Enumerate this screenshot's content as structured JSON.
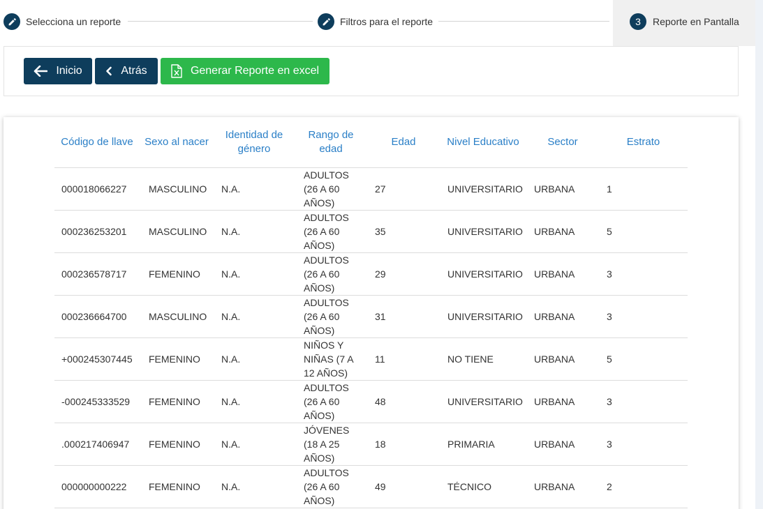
{
  "stepper": {
    "steps": [
      {
        "label": "Selecciona un reporte",
        "icon": "pencil-icon"
      },
      {
        "label": "Filtros para el reporte",
        "icon": "pencil-icon"
      },
      {
        "number": "3",
        "label": "Reporte en Pantalla"
      }
    ]
  },
  "toolbar": {
    "inicio_label": "Inicio",
    "atras_label": "Atrás",
    "excel_label": "Generar Reporte en excel"
  },
  "colors": {
    "primary": "#0e3d5c",
    "success": "#2db84b",
    "header_text": "#2a7fc7"
  },
  "table": {
    "headers": [
      "Código de llave",
      "Sexo al nacer",
      "Identidad de género",
      "Rango de edad",
      "Edad",
      "Nivel Educativo",
      "Sector",
      "Estrato"
    ],
    "rows": [
      [
        "000018066227",
        "MASCULINO",
        "N.A.",
        "ADULTOS (26 A 60 AÑOS)",
        "27",
        "UNIVERSITARIO",
        "URBANA",
        "1"
      ],
      [
        "000236253201",
        "MASCULINO",
        "N.A.",
        "ADULTOS (26 A 60 AÑOS)",
        "35",
        "UNIVERSITARIO",
        "URBANA",
        "5"
      ],
      [
        "000236578717",
        "FEMENINO",
        "N.A.",
        "ADULTOS (26 A 60 AÑOS)",
        "29",
        "UNIVERSITARIO",
        "URBANA",
        "3"
      ],
      [
        "000236664700",
        "MASCULINO",
        "N.A.",
        "ADULTOS (26 A 60 AÑOS)",
        "31",
        "UNIVERSITARIO",
        "URBANA",
        "3"
      ],
      [
        "+000245307445",
        "FEMENINO",
        "N.A.",
        "NIÑOS Y NIÑAS (7 A 12 AÑOS)",
        "11",
        "NO TIENE",
        "URBANA",
        "5"
      ],
      [
        "-000245333529",
        "FEMENINO",
        "N.A.",
        "ADULTOS (26 A 60 AÑOS)",
        "48",
        "UNIVERSITARIO",
        "URBANA",
        "3"
      ],
      [
        ".000217406947",
        "FEMENINO",
        "N.A.",
        "JÓVENES (18 A 25 AÑOS)",
        "18",
        "PRIMARIA",
        "URBANA",
        "3"
      ],
      [
        "000000000222",
        "FEMENINO",
        "N.A.",
        "ADULTOS (26 A 60 AÑOS)",
        "49",
        "TÉCNICO",
        "URBANA",
        "2"
      ]
    ]
  }
}
